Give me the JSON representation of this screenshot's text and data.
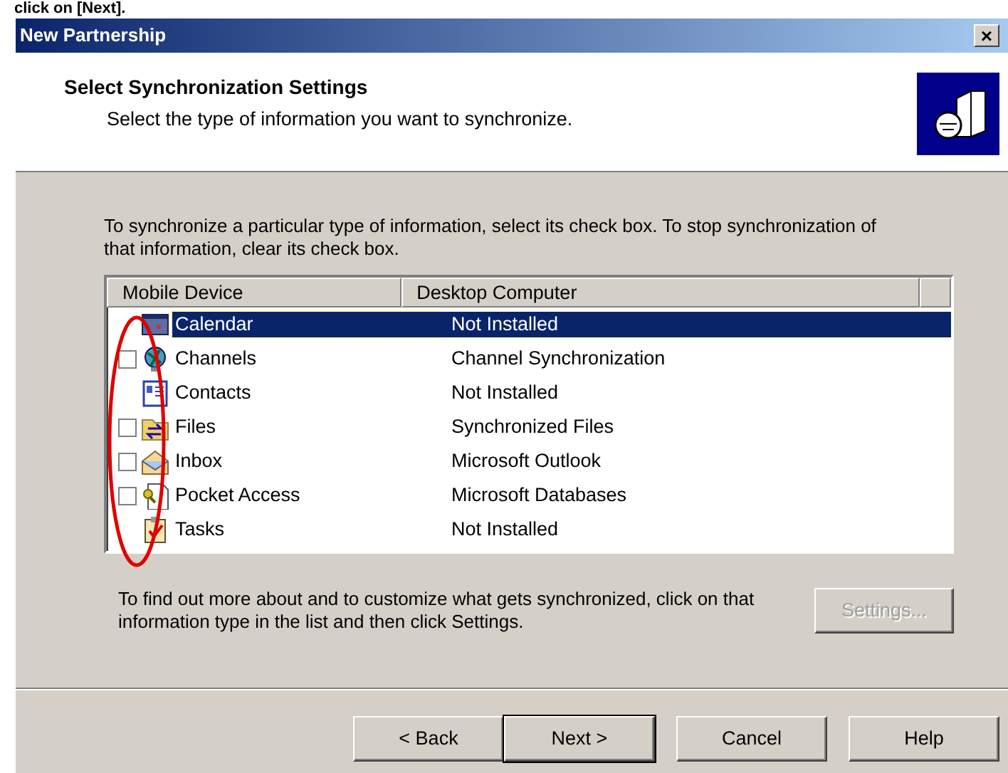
{
  "caption": "click on [Next].",
  "window": {
    "title": "New Partnership",
    "close": "×"
  },
  "header": {
    "title": "Select Synchronization Settings",
    "subtitle": "Select the type of information you want to synchronize."
  },
  "instructions": "To synchronize a particular type of information, select its check box. To stop synchronization of that information, clear its check box.",
  "table": {
    "columns": [
      "Mobile Device",
      "Desktop Computer"
    ],
    "rows": [
      {
        "kind": "plain",
        "name": "Calendar",
        "desktop": "Not Installed",
        "selected": true
      },
      {
        "kind": "checkbox",
        "checked": false,
        "name": "Channels",
        "desktop": "Channel Synchronization",
        "selected": false
      },
      {
        "kind": "plain",
        "name": "Contacts",
        "desktop": "Not Installed",
        "selected": false
      },
      {
        "kind": "checkbox",
        "checked": false,
        "name": "Files",
        "desktop": "Synchronized Files",
        "selected": false
      },
      {
        "kind": "checkbox",
        "checked": false,
        "name": "Inbox",
        "desktop": "Microsoft Outlook",
        "selected": false
      },
      {
        "kind": "checkbox",
        "checked": false,
        "name": "Pocket Access",
        "desktop": "Microsoft Databases",
        "selected": false
      },
      {
        "kind": "plain",
        "name": "Tasks",
        "desktop": "Not Installed",
        "selected": false
      }
    ]
  },
  "hint": "To find out more about and to customize what gets synchronized, click on that information type in the list and then click Settings.",
  "settings_button": {
    "label": "Settings...",
    "disabled": true
  },
  "buttons": [
    {
      "label": "< Back",
      "default": false
    },
    {
      "label": "Next >",
      "default": true
    },
    {
      "label": "Cancel",
      "default": false
    },
    {
      "label": "Help",
      "default": false
    }
  ]
}
